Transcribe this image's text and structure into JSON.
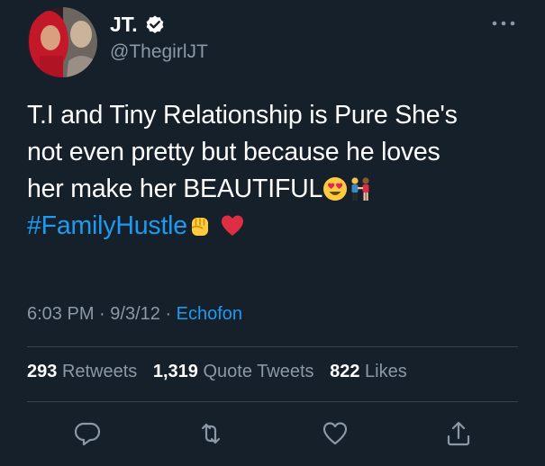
{
  "author": {
    "display_name": "JT.",
    "handle": "@ThegirlJT",
    "verified": true
  },
  "tweet": {
    "line1": "T.I and Tiny Relationship is Pure She's",
    "line2": "not even pretty but because he loves",
    "line3": "her make her BEAUTIFUL",
    "hashtag": "#FamilyHustle",
    "emojis": [
      "heart-eyes-emoji",
      "couple-emoji",
      "raised-fist-emoji",
      "red-heart-emoji"
    ]
  },
  "meta": {
    "time": "6:03 PM",
    "date": "9/3/12",
    "source": "Echofon"
  },
  "stats": {
    "retweets_count": "293",
    "retweets_label": "Retweets",
    "quotes_count": "1,319",
    "quotes_label": "Quote Tweets",
    "likes_count": "822",
    "likes_label": "Likes"
  },
  "actions": [
    "reply-icon",
    "retweet-icon",
    "like-icon",
    "share-icon"
  ],
  "colors": {
    "background": "#15202b",
    "text": "#ffffff",
    "secondary": "#8b98a5",
    "link": "#1d9bf0",
    "divider": "#38444d"
  }
}
